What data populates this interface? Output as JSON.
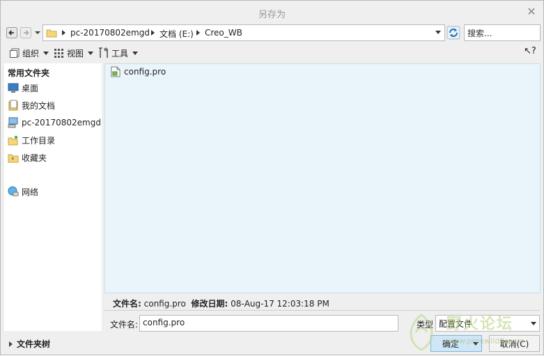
{
  "window": {
    "title": "另存为"
  },
  "address": {
    "segments": [
      "pc-20170802emgd",
      "文档 (E:)",
      "Creo_WB"
    ]
  },
  "search": {
    "placeholder": "搜索..."
  },
  "toolbar": {
    "organize": "组织",
    "view": "视图",
    "tools": "工具"
  },
  "sidebar": {
    "heading": "常用文件夹",
    "items": [
      {
        "label": "桌面",
        "icon": "desktop-icon"
      },
      {
        "label": "我的文档",
        "icon": "documents-icon"
      },
      {
        "label": "pc-20170802emgd",
        "icon": "computer-icon"
      },
      {
        "label": "工作目录",
        "icon": "working-directory-icon"
      },
      {
        "label": "收藏夹",
        "icon": "favorites-icon"
      },
      {
        "label": "网络",
        "icon": "network-icon"
      }
    ]
  },
  "files": [
    {
      "name": "config.pro",
      "icon": "config-file-icon"
    }
  ],
  "info": {
    "name_label": "文件名:",
    "name_value": "config.pro",
    "date_label": "修改日期:",
    "date_value": "08-Aug-17 12:03:18 PM"
  },
  "form": {
    "filename_label": "文件名:",
    "filename_value": "config.pro",
    "type_label": "类型",
    "type_value": "配置文件"
  },
  "folder_tree": {
    "label": "文件夹树"
  },
  "buttons": {
    "ok": "确定",
    "cancel": "取消(C)"
  },
  "watermark": {
    "text": "野火论坛",
    "url": "www.proewildfire.cn"
  },
  "colors": {
    "file_pane_bg": "#eaf5fb",
    "ok_bg": "#cfe6f7"
  }
}
